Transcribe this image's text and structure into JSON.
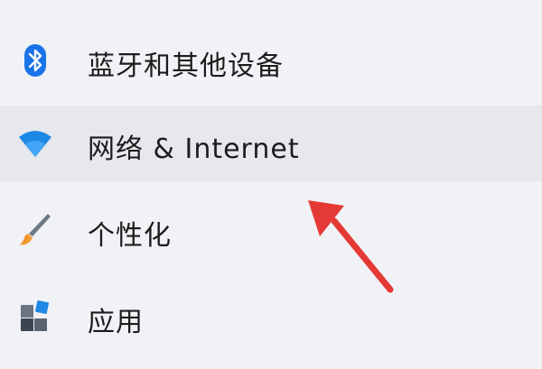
{
  "nav": {
    "items": [
      {
        "label": "蓝牙和其他设备",
        "icon": "bluetooth-icon",
        "selected": false
      },
      {
        "label": "网络 & Internet",
        "icon": "wifi-icon",
        "selected": true
      },
      {
        "label": "个性化",
        "icon": "paintbrush-icon",
        "selected": false
      },
      {
        "label": "应用",
        "icon": "apps-icon",
        "selected": false
      }
    ]
  },
  "annotation": {
    "arrow_color": "#e53935",
    "points_to": "网络 & Internet"
  },
  "colors": {
    "background": "#f1f2f6",
    "selected_row": "#e6e8ed",
    "bluetooth_blue": "#1a73e8",
    "wifi_blue": "#1e88e5",
    "arrow_red": "#e53935"
  }
}
